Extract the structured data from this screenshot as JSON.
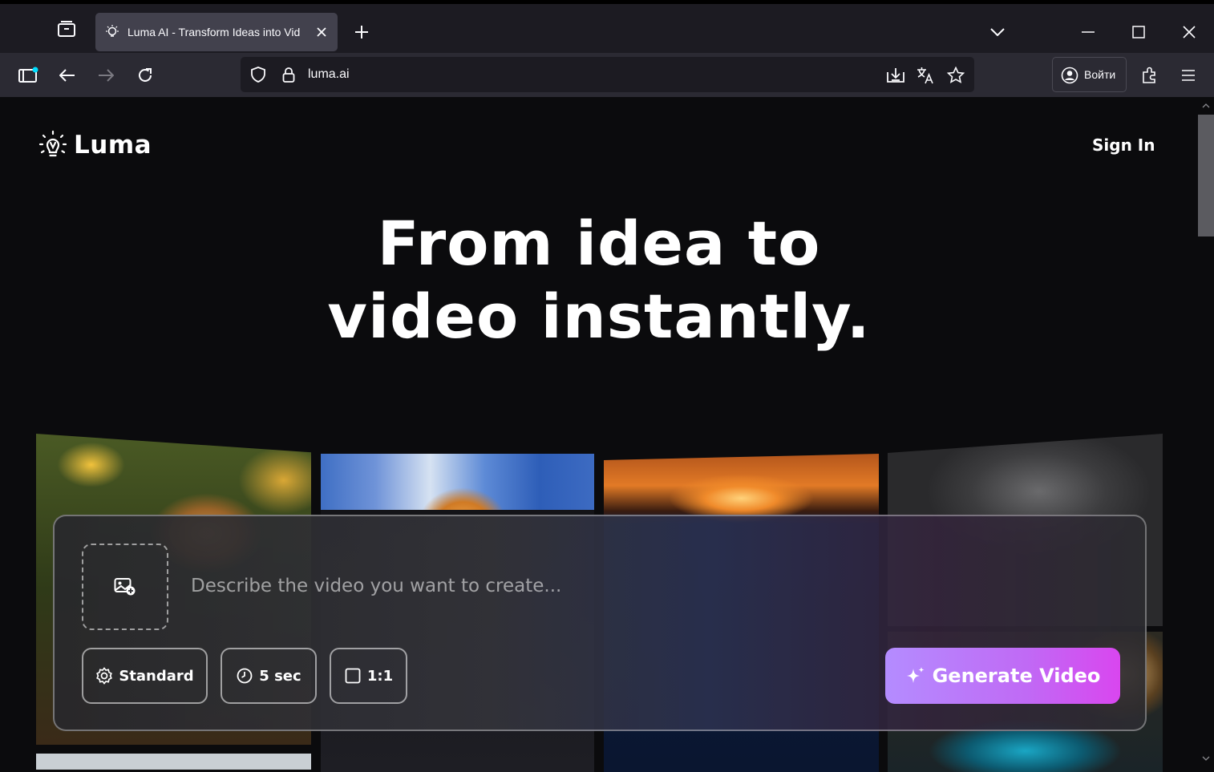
{
  "browser": {
    "tab_title": "Luma AI - Transform Ideas into Vid",
    "url": "luma.ai",
    "signin_label": "Войти"
  },
  "page": {
    "logo_text": "Luma",
    "sign_in": "Sign In",
    "hero_line1": "From idea to",
    "hero_line2": "video instantly.",
    "prompt_placeholder": "Describe the video you want to create...",
    "options": {
      "quality": "Standard",
      "duration": "5 sec",
      "aspect": "1:1"
    },
    "generate_label": "Generate Video"
  },
  "colors": {
    "accent_start": "#b48cff",
    "accent_end": "#d946ef",
    "background": "#0b0b0d"
  }
}
